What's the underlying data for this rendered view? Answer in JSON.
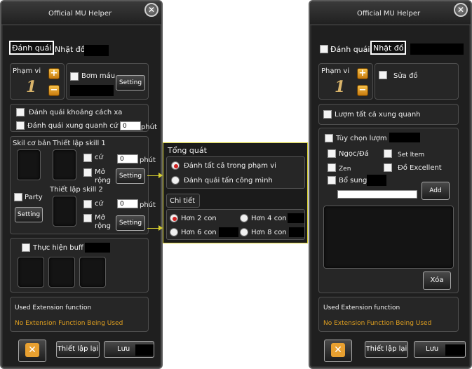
{
  "left": {
    "title": "Official MU Helper",
    "tabs": [
      "Đánh quái",
      "Nhặt đồ"
    ],
    "range_label": "Phạm vi",
    "range_value": "1",
    "potion_label": "Bơm máu",
    "setting": "Setting",
    "fight_distance": "Đánh quái khoảng cách xa",
    "fight_around": "Đánh quái xung quanh cứ",
    "fight_around_value": "0",
    "minute": "phút",
    "basic_skill": "Skil cơ bản",
    "skill1": "Thiết lập skill 1",
    "skill2": "Thiết lập skill 2",
    "each": "cứ",
    "expand": "Mở rộng",
    "skill1_value": "0",
    "skill2_value": "0",
    "party": "Party",
    "buff": "Thực hiện buff",
    "ext_title": "Used Extension function",
    "ext_status": "No Extension Function Being Used",
    "reset": "Thiết lập lại",
    "save": "Lưu",
    "close_glyph": "✕"
  },
  "popup": {
    "general": "Tổng quát",
    "opt_all": "Đánh tất cả trong phạm vi",
    "opt_attack": "Đánh quái tấn công mình",
    "detail": "Chi tiết",
    "more2": "Hơn 2 con",
    "more4": "Hơn 4 con",
    "more6": "Hơn 6 con",
    "more8": "Hơn 8 con"
  },
  "right": {
    "title": "Official MU Helper",
    "tabs": [
      "Đánh quái",
      "Nhặt đồ"
    ],
    "range_label": "Phạm vi",
    "range_value": "1",
    "repair": "Sửa đồ",
    "pick_all": "Lượm tất cả xung quanh",
    "pick_option": "Tùy chọn lượm",
    "jewel": "Ngọc/Đá",
    "set_item": "Set Item",
    "zen": "Zen",
    "excellent": "Đồ Excellent",
    "extra": "Bổ sung",
    "add": "Add",
    "delete": "Xóa",
    "ext_title": "Used Extension function",
    "ext_status": "No Extension Function Being Used",
    "reset": "Thiết lập lại",
    "save": "Lưu",
    "close_glyph": "✕"
  },
  "colors": {
    "accent_yellow": "#d8d030",
    "status_orange": "#e0a020",
    "gold": "#f7c24a"
  }
}
